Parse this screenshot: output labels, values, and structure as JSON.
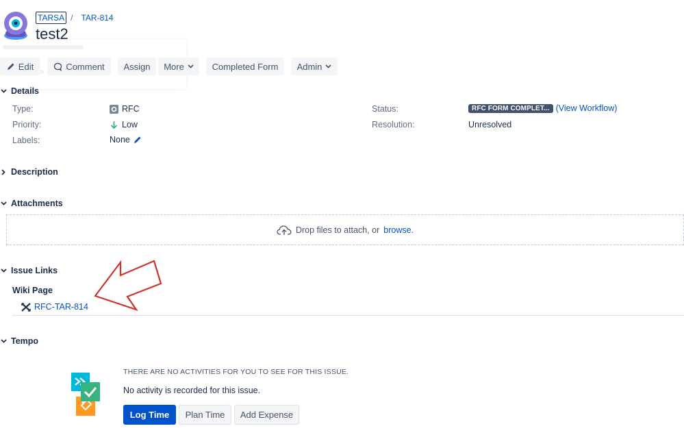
{
  "header": {
    "project": "TARSA",
    "separator": "/",
    "issue_key": "TAR-814",
    "title": "test2"
  },
  "toolbar": {
    "edit": "Edit",
    "comment": "Comment",
    "assign": "Assign",
    "more": "More",
    "completed_form": "Completed Form",
    "admin": "Admin"
  },
  "details": {
    "heading": "Details",
    "type_label": "Type:",
    "type_value": "RFC",
    "priority_label": "Priority:",
    "priority_value": "Low",
    "labels_label": "Labels:",
    "labels_value": "None",
    "status_label": "Status:",
    "status_value": "RFC FORM COMPLET...",
    "view_workflow": "(View Workflow)",
    "resolution_label": "Resolution:",
    "resolution_value": "Unresolved"
  },
  "description": {
    "heading": "Description"
  },
  "attachments": {
    "heading": "Attachments",
    "drop_text": "Drop files to attach, or",
    "browse": "browse."
  },
  "issue_links": {
    "heading": "Issue Links",
    "group": "Wiki Page",
    "link": "RFC-TAR-814"
  },
  "tempo": {
    "heading": "Tempo",
    "empty_heading": "THERE ARE NO ACTIVITIES FOR YOU TO SEE FOR THIS ISSUE.",
    "empty_text": "No activity is recorded for this issue.",
    "log_time": "Log Time",
    "plan_time": "Plan Time",
    "add_expense": "Add Expense"
  },
  "colors": {
    "link": "#0052cc",
    "primary_button": "#0052cc",
    "status_lozenge": "#42526e",
    "annotation_arrow": "#d0312d",
    "tempo_blue": "#00b8d9",
    "tempo_green": "#36b37e",
    "tempo_orange": "#ff991f"
  },
  "icons": [
    "project-avatar-icon",
    "pencil-icon",
    "comment-icon",
    "chevron-down-icon",
    "rfc-type-icon",
    "arrow-down-icon",
    "cloud-upload-icon",
    "confluence-link-icon",
    "tempo-logo-icon"
  ]
}
